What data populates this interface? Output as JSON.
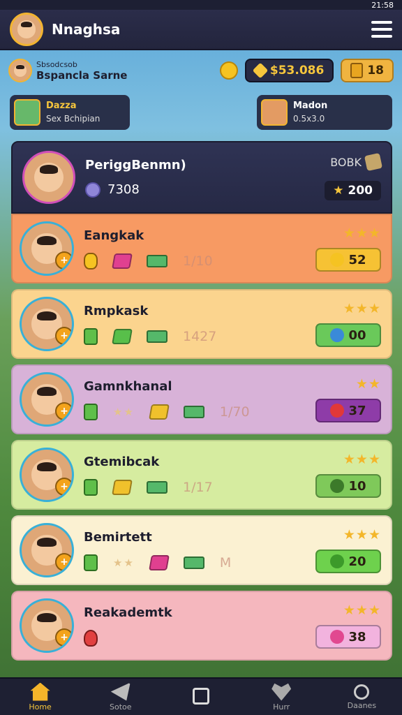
{
  "status": {
    "time": "21:58"
  },
  "header": {
    "title": "Nnaghsa"
  },
  "player": {
    "label": "Sbsodcsob",
    "name": "Bspancla Sarne"
  },
  "currency": {
    "gold": "$53.086",
    "tickets": "18"
  },
  "teams": [
    {
      "top": "Dazza",
      "sub": "Sex Bchipian"
    },
    {
      "top": "Madon",
      "sub": "0.5x3.0"
    }
  ],
  "feature": {
    "name": "PeriggBenmn)",
    "score": "7308",
    "back_label": "BOBK",
    "badge_value": "200"
  },
  "rows": [
    {
      "name": "Eangkak",
      "value": "1/10",
      "reward": "52",
      "stars": "★★★",
      "color": "#f79a63",
      "btn_color": "#f6c234",
      "btn_icon_color": "#f5c322"
    },
    {
      "name": "Rmpkask",
      "value": "1427",
      "reward": "00",
      "stars": "★★★",
      "color": "#fbd48e",
      "btn_color": "#6ac95a",
      "btn_icon_color": "#3a8ad8"
    },
    {
      "name": "Gamnkhanal",
      "value": "1/70",
      "reward": "37",
      "stars": "★★",
      "color": "#d8b2d8",
      "btn_color": "#8e3ca8",
      "btn_icon_color": "#e13838"
    },
    {
      "name": "Gtemibcak",
      "value": "1/17",
      "reward": "10",
      "stars": "★★★",
      "color": "#d6eca0",
      "btn_color": "#7fc95a",
      "btn_icon_color": "#3c7a2a"
    },
    {
      "name": "Bemirtett",
      "value": "M",
      "reward": "20",
      "stars": "★★★",
      "color": "#fbf1d2",
      "btn_color": "#6ed14d",
      "btn_icon_color": "#3c9a2a"
    },
    {
      "name": "Reakademtk",
      "value": "",
      "reward": "38",
      "stars": "★★★",
      "color": "#f5b7be",
      "btn_color": "#f2b3de",
      "btn_icon_color": "#e14890"
    }
  ],
  "tabs": [
    {
      "label": "Home",
      "icon": "home-icon"
    },
    {
      "label": "Sotoe",
      "icon": "send-icon"
    },
    {
      "label": "",
      "icon": "shop-icon"
    },
    {
      "label": "Hurr",
      "icon": "heart-icon"
    },
    {
      "label": "Daanes",
      "icon": "search-icon"
    }
  ]
}
